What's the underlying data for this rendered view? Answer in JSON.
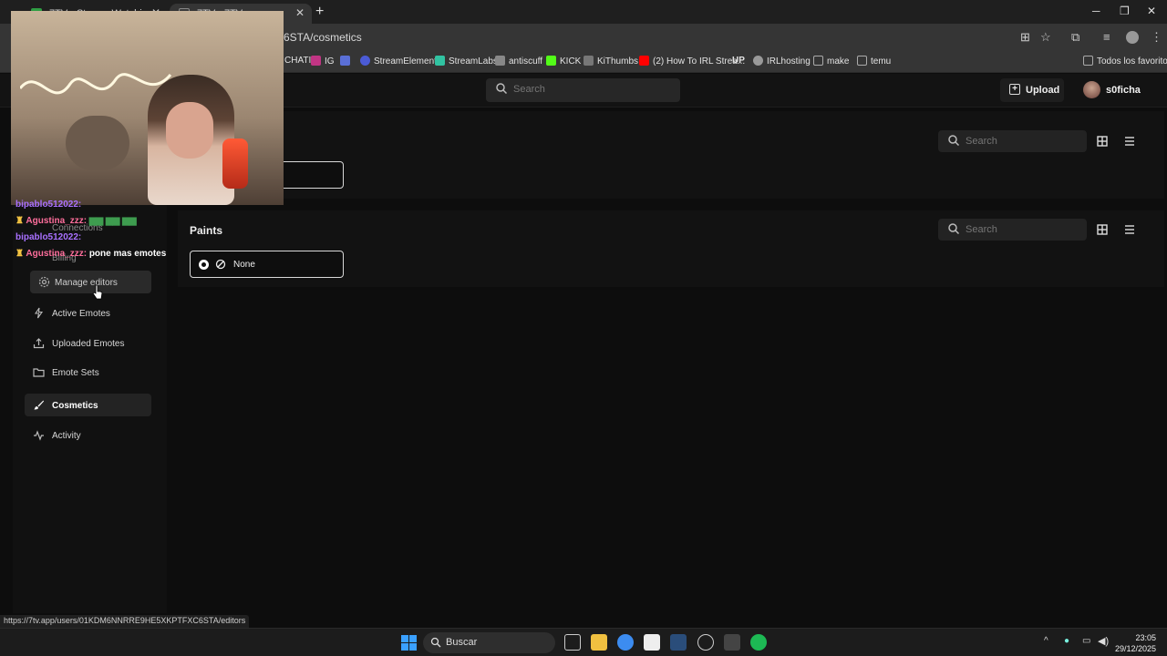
{
  "browser": {
    "tabs": [
      {
        "title": "7TV - Stream Watching w..."
      },
      {
        "title": "7TV - 7TV"
      }
    ],
    "new_tab": "+",
    "url_visible": "6STA/cosmetics",
    "window_controls": {
      "minimize": "─",
      "maximize": "❐",
      "close": "✕"
    },
    "bookmarks": [
      {
        "label": "CHATI",
        "color": "#444444"
      },
      {
        "label": "IG",
        "color": "#c13584"
      },
      {
        "label": "",
        "color": "#5a6fd6"
      },
      {
        "label": "StreamElements",
        "color": "#4b5bd6"
      },
      {
        "label": "StreamLabs",
        "color": "#31c3a2"
      },
      {
        "label": "antiscuff",
        "color": "#888888"
      },
      {
        "label": "KICK",
        "color": "#53fc18"
      },
      {
        "label": "KiThumbs",
        "color": "#777777"
      },
      {
        "label": "(2) How To IRL Strea...",
        "color": "#ff0000"
      },
      {
        "label": "UP",
        "color": "#111111"
      },
      {
        "label": "IRLhosting",
        "color": "#999999"
      },
      {
        "label": "make",
        "color": "#aaaaaa"
      },
      {
        "label": "temu",
        "color": "#aaaaaa"
      }
    ],
    "all_bookmarks": "Todos los favoritos"
  },
  "header": {
    "search_placeholder": "Search",
    "upload_label": "Upload",
    "username": "s0ficha"
  },
  "sidebar": {
    "items": [
      {
        "label": "Manage editors",
        "icon": "gear-icon"
      },
      {
        "label": "Active Emotes",
        "icon": "bolt-icon"
      },
      {
        "label": "Uploaded Emotes",
        "icon": "upload-icon"
      },
      {
        "label": "Emote Sets",
        "icon": "folder-icon"
      },
      {
        "label": "Cosmetics",
        "icon": "brush-icon",
        "active": true
      },
      {
        "label": "Activity",
        "icon": "activity-icon"
      }
    ],
    "partially_hidden": [
      "Connections",
      "Billing"
    ]
  },
  "main": {
    "badges_section": {
      "search_placeholder": "Search"
    },
    "paints_section": {
      "title": "Paints",
      "search_placeholder": "Search",
      "options": [
        {
          "label": "None",
          "selected": true
        }
      ]
    }
  },
  "overlay_chat": [
    {
      "user": "bipablo512022:",
      "message": "",
      "color": "#a970ff"
    },
    {
      "user": "Agustina_zzz:",
      "message": "",
      "color": "#ff6e9c"
    },
    {
      "user": "bipablo512022:",
      "message": "",
      "color": "#a970ff"
    },
    {
      "user": "Agustina_zzz:",
      "message": "pone mas emotes",
      "color": "#ff6e9c"
    }
  ],
  "status_url": "https://7tv.app/users/01KDM6NNRRE9HE5XKPTFXC6STA/editors",
  "taskbar": {
    "search_label": "Buscar",
    "time": "23:05",
    "date": "29/12/2025"
  },
  "colors": {
    "background": "#0d0d0d",
    "panel": "#121212",
    "active_nav": "#232323",
    "accent_text": "#ffffff"
  }
}
